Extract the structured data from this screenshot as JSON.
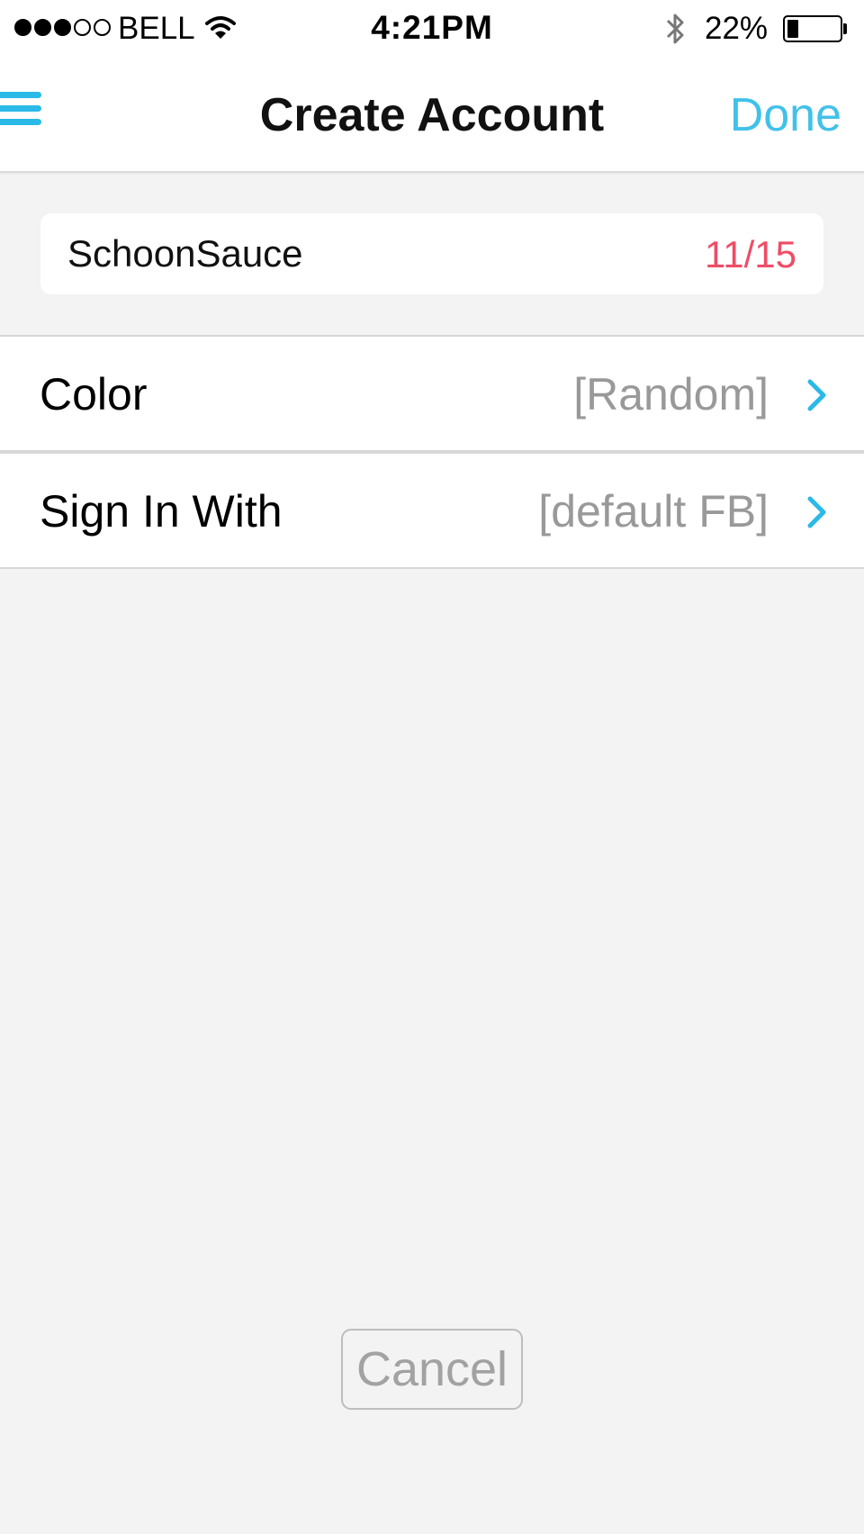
{
  "status_bar": {
    "signal_filled": 3,
    "signal_total": 5,
    "carrier": "BELL",
    "time": "4:21PM",
    "battery_percent": "22%",
    "battery_level": 0.22,
    "icons": [
      "wifi-icon",
      "bluetooth-icon",
      "battery-icon"
    ]
  },
  "nav": {
    "title": "Create Account",
    "done_label": "Done",
    "menu_icon": "hamburger-menu-icon"
  },
  "form": {
    "username_value": "SchoonSauce",
    "char_count": "11/15"
  },
  "rows": [
    {
      "label": "Color",
      "value": "[Random]"
    },
    {
      "label": "Sign In With",
      "value": "[default FB]"
    }
  ],
  "cancel_label": "Cancel",
  "colors": {
    "accent": "#41c1ea",
    "counter": "#ee4d67",
    "secondary_text": "#999999",
    "background": "#f3f3f3"
  }
}
